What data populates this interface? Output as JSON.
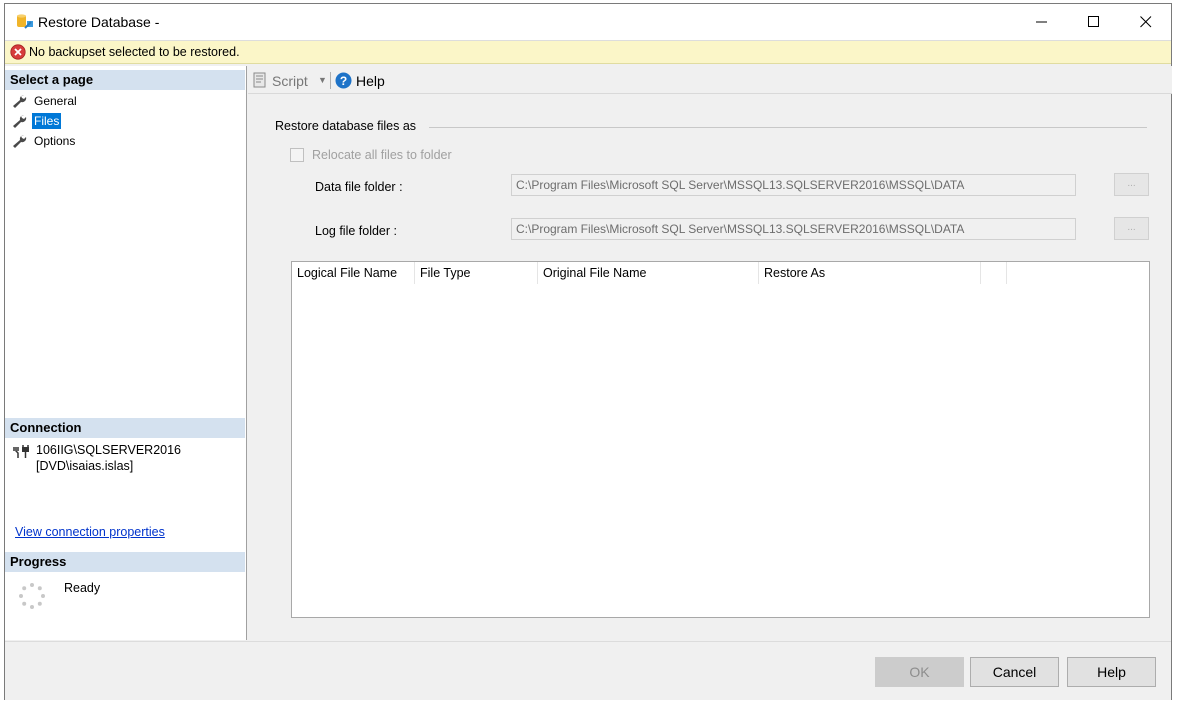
{
  "window": {
    "title": "Restore Database -"
  },
  "error": {
    "message": "No backupset selected to be restored."
  },
  "left": {
    "select_page_header": "Select a page",
    "pages": [
      {
        "label": "General"
      },
      {
        "label": "Files",
        "selected": true
      },
      {
        "label": "Options"
      }
    ],
    "connection_header": "Connection",
    "connection_server": "106IIG\\SQLSERVER2016",
    "connection_user": "[DVD\\isaias.islas]",
    "connection_link": "View connection properties",
    "progress_header": "Progress",
    "progress_status": "Ready"
  },
  "toolbar": {
    "script_label": "Script",
    "help_label": "Help"
  },
  "files": {
    "group_title": "Restore database files as",
    "relocate_label": "Relocate all files to folder",
    "relocate_checked": false,
    "data_folder_label": "Data file folder :",
    "data_folder_value": "C:\\Program Files\\Microsoft SQL Server\\MSSQL13.SQLSERVER2016\\MSSQL\\DATA",
    "log_folder_label": "Log file folder :",
    "log_folder_value": "C:\\Program Files\\Microsoft SQL Server\\MSSQL13.SQLSERVER2016\\MSSQL\\DATA",
    "browse_label": "...",
    "columns": [
      "Logical File Name",
      "File Type",
      "Original File Name",
      "Restore As"
    ]
  },
  "buttons": {
    "ok": "OK",
    "cancel": "Cancel",
    "help": "Help"
  },
  "colors": {
    "selected": "#0078d7",
    "error_bar": "#fbf6c8",
    "section_header": "#d4e1ef",
    "link": "#0033cc"
  }
}
